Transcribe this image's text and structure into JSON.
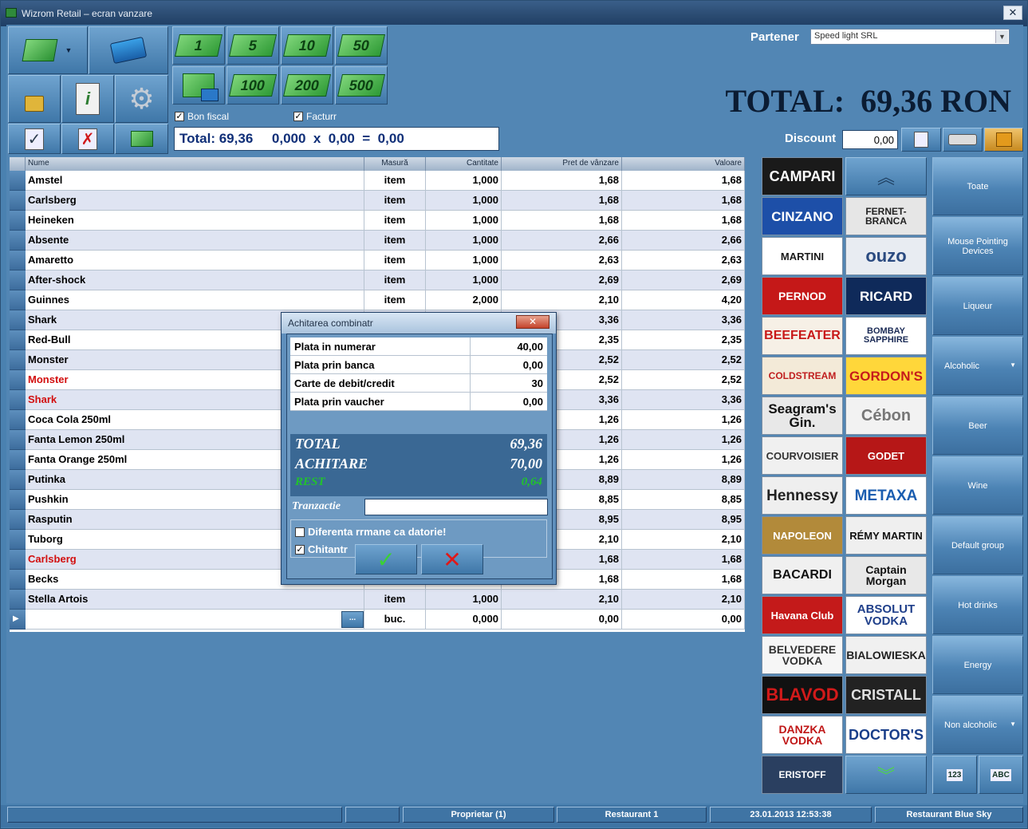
{
  "window": {
    "title": "Wizrom Retail – ecran vanzare",
    "close": "✕"
  },
  "toolbar": {
    "notes": [
      "1",
      "5",
      "10",
      "50",
      "100",
      "200",
      "500"
    ],
    "bon_fiscal": "Bon fiscal",
    "facturr": "Facturr",
    "totalbar": "Total: 69,36     0,000  x  0,00  =  0,00"
  },
  "partener": {
    "label": "Partener",
    "value": "Speed light SRL"
  },
  "total": {
    "text": "TOTAL:  69,36 RON"
  },
  "discount": {
    "label": "Discount",
    "value": "0,00"
  },
  "grid": {
    "headers": [
      "Nume",
      "Masură",
      "Cantitate",
      "Pret de vânzare",
      "Valoare"
    ],
    "rows": [
      {
        "name": "Amstel",
        "unit": "item",
        "qty": "1,000",
        "price": "1,68",
        "value": "1,68",
        "red": false
      },
      {
        "name": "Carlsberg",
        "unit": "item",
        "qty": "1,000",
        "price": "1,68",
        "value": "1,68",
        "red": false
      },
      {
        "name": "Heineken",
        "unit": "item",
        "qty": "1,000",
        "price": "1,68",
        "value": "1,68",
        "red": false
      },
      {
        "name": "Absente",
        "unit": "item",
        "qty": "1,000",
        "price": "2,66",
        "value": "2,66",
        "red": false
      },
      {
        "name": "Amaretto",
        "unit": "item",
        "qty": "1,000",
        "price": "2,63",
        "value": "2,63",
        "red": false
      },
      {
        "name": "After-shock",
        "unit": "item",
        "qty": "1,000",
        "price": "2,69",
        "value": "2,69",
        "red": false
      },
      {
        "name": "Guinnes",
        "unit": "item",
        "qty": "2,000",
        "price": "2,10",
        "value": "4,20",
        "red": false
      },
      {
        "name": "Shark",
        "unit": "",
        "qty": "",
        "price": "3,36",
        "value": "3,36",
        "red": false
      },
      {
        "name": "Red-Bull",
        "unit": "",
        "qty": "",
        "price": "2,35",
        "value": "2,35",
        "red": false
      },
      {
        "name": "Monster",
        "unit": "",
        "qty": "",
        "price": "2,52",
        "value": "2,52",
        "red": false
      },
      {
        "name": "Monster",
        "unit": "",
        "qty": "",
        "price": "2,52",
        "value": "2,52",
        "red": true
      },
      {
        "name": "Shark",
        "unit": "",
        "qty": "",
        "price": "3,36",
        "value": "3,36",
        "red": true
      },
      {
        "name": "Coca Cola 250ml",
        "unit": "",
        "qty": "",
        "price": "1,26",
        "value": "1,26",
        "red": false
      },
      {
        "name": "Fanta Lemon 250ml",
        "unit": "",
        "qty": "",
        "price": "1,26",
        "value": "1,26",
        "red": false
      },
      {
        "name": "Fanta Orange 250ml",
        "unit": "",
        "qty": "",
        "price": "1,26",
        "value": "1,26",
        "red": false
      },
      {
        "name": "Putinka",
        "unit": "",
        "qty": "",
        "price": "8,89",
        "value": "8,89",
        "red": false
      },
      {
        "name": "Pushkin",
        "unit": "",
        "qty": "",
        "price": "8,85",
        "value": "8,85",
        "red": false
      },
      {
        "name": "Rasputin",
        "unit": "",
        "qty": "",
        "price": "8,95",
        "value": "8,95",
        "red": false
      },
      {
        "name": "Tuborg",
        "unit": "",
        "qty": "",
        "price": "2,10",
        "value": "2,10",
        "red": false
      },
      {
        "name": "Carlsberg",
        "unit": "",
        "qty": "",
        "price": "1,68",
        "value": "1,68",
        "red": true
      },
      {
        "name": "Becks",
        "unit": "",
        "qty": "",
        "price": "1,68",
        "value": "1,68",
        "red": false
      },
      {
        "name": "Stella Artois",
        "unit": "item",
        "qty": "1,000",
        "price": "2,10",
        "value": "2,10",
        "red": false
      },
      {
        "name": "",
        "unit": "buc.",
        "qty": "0,000",
        "price": "0,00",
        "value": "0,00",
        "red": false
      }
    ],
    "ellipsis": "..."
  },
  "brands": [
    [
      "CAMPARI",
      ""
    ],
    [
      "CINZANO",
      "FERNET-BRANCA"
    ],
    [
      "MARTINI",
      "ouzo"
    ],
    [
      "PERNOD",
      "RICARD"
    ],
    [
      "BEEFEATER",
      "BOMBAY SAPPHIRE"
    ],
    [
      "COLDSTREAM",
      "GORDON'S"
    ],
    [
      "Seagram's Gin.",
      "Cébon"
    ],
    [
      "COURVOISIER",
      "GODET"
    ],
    [
      "Hennessy",
      "METAXA"
    ],
    [
      "NAPOLEON",
      "RÉMY MARTIN"
    ],
    [
      "BACARDI",
      "Captain Morgan"
    ],
    [
      "Havana Club",
      "ABSOLUT VODKA"
    ],
    [
      "BELVEDERE VODKA",
      "BIALOWIESKA"
    ],
    [
      "BLAVOD",
      "CRISTALL"
    ],
    [
      "DANZKA VODKA",
      "DOCTOR'S"
    ],
    [
      "ERISTOFF",
      ""
    ]
  ],
  "categories": [
    "Toate",
    "Mouse  Pointing Devices",
    "Liqueur",
    "Alcoholic",
    "Beer",
    "Wine",
    "Default group",
    "Hot drinks",
    "Energy",
    "Non alcoholic"
  ],
  "sort_icons": [
    "123",
    "ABC"
  ],
  "dialog": {
    "title": "Achitarea combinatr",
    "close": "✕",
    "payments": [
      {
        "label": "Plata in numerar",
        "value": "40,00"
      },
      {
        "label": "Plata prin banca",
        "value": "0,00"
      },
      {
        "label": "Carte de debit/credit",
        "value": "30"
      },
      {
        "label": "Plata prin vaucher",
        "value": "0,00"
      }
    ],
    "total_label": "TOTAL",
    "total_value": "69,36",
    "achitare_label": "ACHITARE",
    "achitare_value": "70,00",
    "rest_label": "REST",
    "rest_value": "0,64",
    "tranzactie_label": "Tranzactie",
    "tranzactie_value": "",
    "diferenta": "Diferenta rrmane ca datorie!",
    "chitantr": "Chitantr"
  },
  "status": [
    "",
    "",
    "Proprietar (1)",
    "Restaurant 1",
    "23.01.2013 12:53:38",
    "Restaurant Blue Sky"
  ]
}
